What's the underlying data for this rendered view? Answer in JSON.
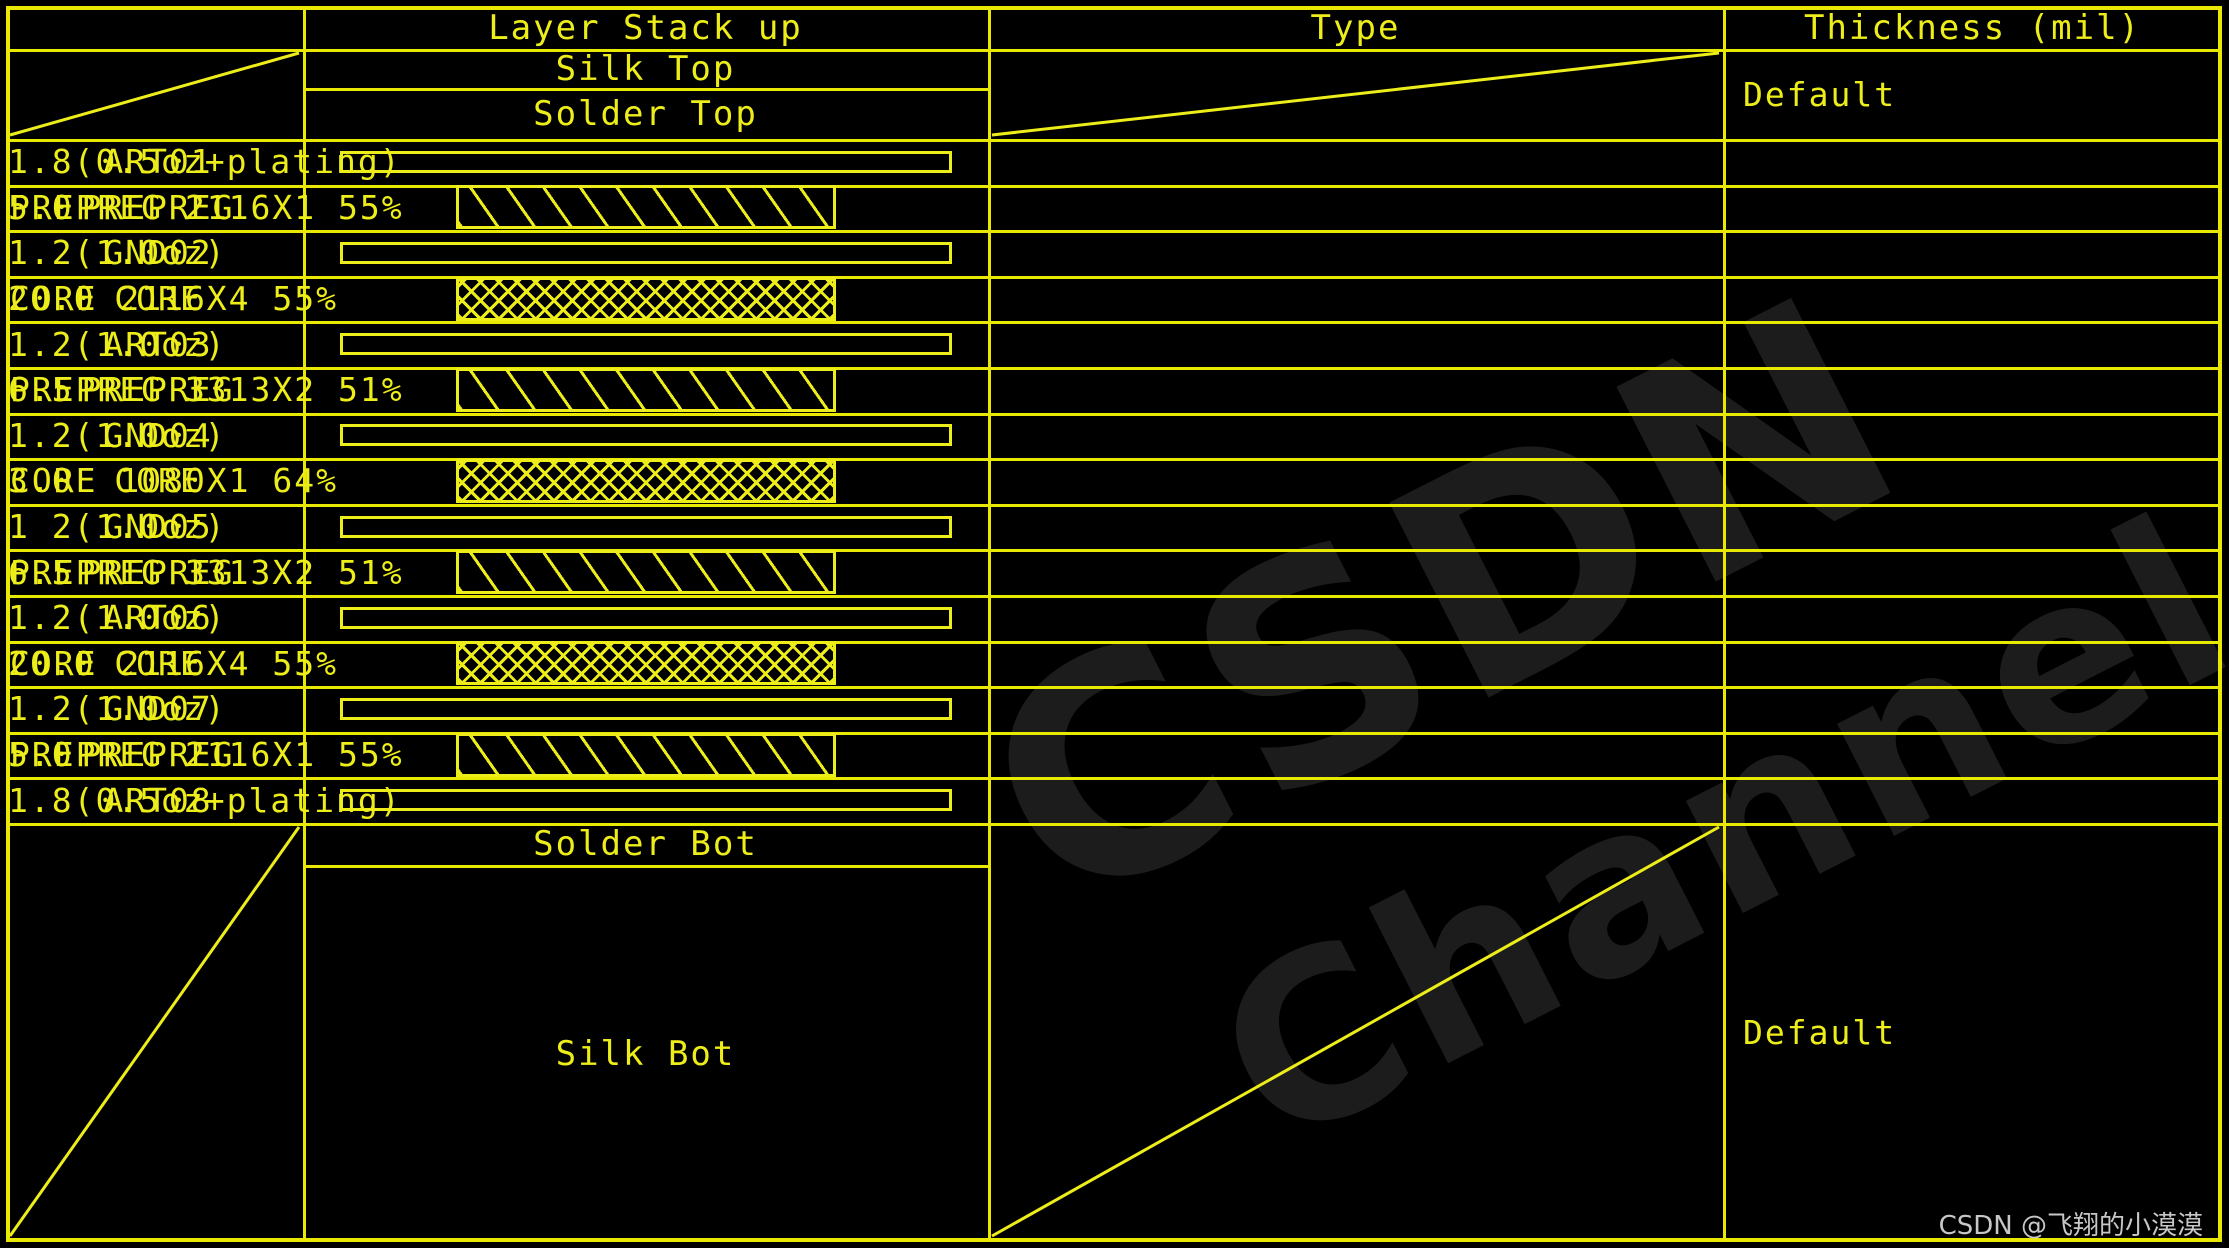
{
  "headers": {
    "col_layer_name": "",
    "col_stackup": "Layer Stack up",
    "col_type": "Type",
    "col_thickness": "Thickness (mil)"
  },
  "top_rows": {
    "silk_top": "Silk Top",
    "solder_top": "Solder Top",
    "default_thickness": "Default"
  },
  "bottom_rows": {
    "solder_bot": "Solder Bot",
    "silk_bot": "Silk Bot",
    "default_thickness": "Default"
  },
  "stackup_rows": [
    {
      "name": "ART01",
      "kind": "copper",
      "type": "",
      "thickness": "1.8(0.5oz+plating)"
    },
    {
      "name": "PREPREG",
      "kind": "prepreg",
      "type": "PREPREG 2116X1 55%",
      "thickness": "5.0"
    },
    {
      "name": "GND02",
      "kind": "copper",
      "type": "",
      "thickness": "1.2(1.0oz)"
    },
    {
      "name": "CORE",
      "kind": "core",
      "type": "CORE   2116X4   55%",
      "thickness": "20.0"
    },
    {
      "name": "ART03",
      "kind": "copper",
      "type": "",
      "thickness": "1.2(1.0oz)"
    },
    {
      "name": "PREPREG",
      "kind": "prepreg",
      "type": "PREPREG 3313X2  51%",
      "thickness": "6.5"
    },
    {
      "name": "GND04",
      "kind": "copper",
      "type": "",
      "thickness": "1.2(1.0oz)"
    },
    {
      "name": "CORE",
      "kind": "core",
      "type": "CORE   1080X1   64%",
      "thickness": "3.0"
    },
    {
      "name": "GND05",
      "kind": "copper",
      "type": "",
      "thickness": "1 2(1.0oz)"
    },
    {
      "name": "PREPREG",
      "kind": "prepreg",
      "type": "PREPREG 3313X2   51%",
      "thickness": "6.5"
    },
    {
      "name": "ART06",
      "kind": "copper",
      "type": "",
      "thickness": "1.2(1.0oz)"
    },
    {
      "name": "CORE",
      "kind": "core",
      "type": "CORE   2116X4   55%",
      "thickness": "20.0"
    },
    {
      "name": "GND07",
      "kind": "copper",
      "type": "",
      "thickness": "1.2(1.0oz)"
    },
    {
      "name": "PREPREG",
      "kind": "prepreg",
      "type": "PREPREG 2116X1 55%",
      "thickness": "5.0"
    },
    {
      "name": "ART08",
      "kind": "copper",
      "type": "",
      "thickness": "1.8(0.5oz+plating)"
    }
  ],
  "watermark": {
    "big_text_1": "CSDN",
    "big_text_2": "Channel",
    "credit": "CSDN @飞翔的小漠漠"
  },
  "colors": {
    "background": "#000000",
    "line": "#e8e800",
    "text": "#eded1a",
    "watermark": "#d8d8d8"
  }
}
